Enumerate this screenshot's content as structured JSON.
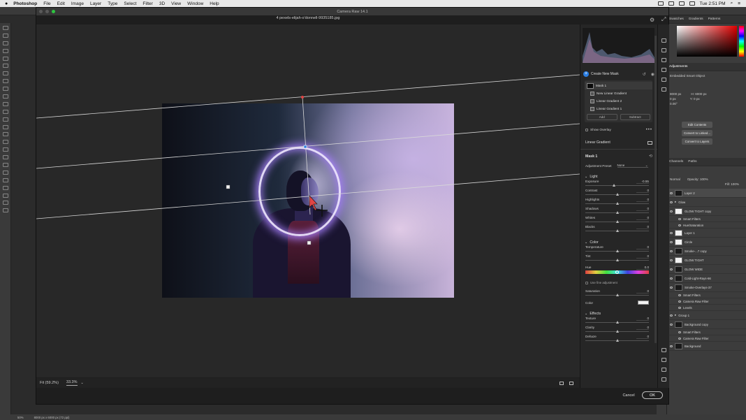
{
  "menubar": {
    "app_name": "Photoshop",
    "items": [
      "File",
      "Edit",
      "Image",
      "Layer",
      "Type",
      "Select",
      "Filter",
      "3D",
      "View",
      "Window",
      "Help"
    ],
    "clock": "Tue 2:51 PM"
  },
  "dialog": {
    "title": "Camera Raw 14.1",
    "filename": "4 pexels-elijah-o'donnell-9935185.jpg",
    "zoom_fit": "Fit (59.2%)",
    "zoom_value": "33.3%",
    "cancel_label": "Cancel",
    "ok_label": "OK"
  },
  "masks_panel": {
    "create_new": "Create New Mask",
    "masks": [
      {
        "label": "Mask 1",
        "level": 0
      },
      {
        "label": "New Linear Gradient",
        "level": 1
      },
      {
        "label": "Linear Gradient 2",
        "level": 1
      },
      {
        "label": "Linear Gradient 1",
        "level": 1
      }
    ],
    "add_label": "Add",
    "subtract_label": "Subtract",
    "show_overlay": "Show Overlay",
    "more": "•••",
    "tool_name": "Linear Gradient",
    "mask_name": "Mask 1",
    "adjustment_preset_label": "Adjustment Preset",
    "adjustment_preset_value": "None"
  },
  "light": {
    "title": "Light",
    "sliders": [
      {
        "label": "Exposure",
        "value": "-0.55",
        "pos": 0.45
      },
      {
        "label": "Contrast",
        "value": "0",
        "pos": 0.5
      },
      {
        "label": "Highlights",
        "value": "0",
        "pos": 0.5
      },
      {
        "label": "Shadows",
        "value": "0",
        "pos": 0.5
      },
      {
        "label": "Whites",
        "value": "0",
        "pos": 0.5
      },
      {
        "label": "Blacks",
        "value": "0",
        "pos": 0.5
      }
    ]
  },
  "color": {
    "title": "Color",
    "sliders": [
      {
        "label": "Temperature",
        "value": "0",
        "pos": 0.5
      },
      {
        "label": "Tint",
        "value": "0",
        "pos": 0.5
      }
    ],
    "hue_label": "Hue",
    "hue_value": "0.0",
    "hue_pos": 0.5,
    "fine_adjustment": "Use fine adjustment",
    "saturation_label": "Saturation",
    "saturation_value": "0",
    "saturation_pos": 0.5,
    "color_label": "Color",
    "swatch_color": "#f2f2f2"
  },
  "effects": {
    "title": "Effects",
    "sliders": [
      {
        "label": "Texture",
        "value": "0",
        "pos": 0.5
      },
      {
        "label": "Clarity",
        "value": "0",
        "pos": 0.5
      },
      {
        "label": "Dehaze",
        "value": "0",
        "pos": 0.5
      }
    ]
  },
  "ps_panels": {
    "top_tabs": [
      "Swatches",
      "Gradients",
      "Patterns"
    ],
    "props_tabs": [
      "Adjustments"
    ],
    "embedded_label": "Embedded Smart Object",
    "w_label": "8000 px",
    "h_label": "H: 6000 px",
    "x_label": "0 px",
    "y_label": "Y: 0 px",
    "angle": "0.00°",
    "buttons": [
      "Edit Contents",
      "Convert to Linked...",
      "Convert to Layers"
    ],
    "layer_tabs": [
      "Channels",
      "Paths"
    ],
    "blend": "Normal",
    "opacity": "Opacity: 100%",
    "fill": "Fill: 100%",
    "layers": [
      {
        "name": "Layer 2",
        "kind": "layer",
        "white": false,
        "sel": true
      },
      {
        "name": "Glow",
        "kind": "group",
        "white": false,
        "sel": false
      },
      {
        "name": "GLOW TIGHT copy",
        "kind": "layer",
        "white": true,
        "sel": false
      },
      {
        "name": "Smart Filters",
        "kind": "sub",
        "white": false,
        "sel": false
      },
      {
        "name": "Hue/Saturation",
        "kind": "sub",
        "white": false,
        "sel": false
      },
      {
        "name": "Layer 1",
        "kind": "layer",
        "white": true,
        "sel": false
      },
      {
        "name": "Circle",
        "kind": "layer",
        "white": true,
        "sel": false
      },
      {
        "name": "Smoke-...7 copy",
        "kind": "layer",
        "white": false,
        "sel": false
      },
      {
        "name": "GLOW TIGHT",
        "kind": "layer",
        "white": true,
        "sel": false
      },
      {
        "name": "GLOW WIDE",
        "kind": "layer",
        "white": false,
        "sel": false
      },
      {
        "name": "Cold-Light-Rays-66",
        "kind": "layer",
        "white": false,
        "sel": false
      },
      {
        "name": "Smoke-Overlays-37",
        "kind": "layer",
        "white": false,
        "sel": false
      },
      {
        "name": "Smart Filters",
        "kind": "sub",
        "white": false,
        "sel": false
      },
      {
        "name": "Camera Raw Filter",
        "kind": "sub",
        "white": false,
        "sel": false
      },
      {
        "name": "Levels",
        "kind": "sub",
        "white": false,
        "sel": false
      },
      {
        "name": "Group 1",
        "kind": "group",
        "white": false,
        "sel": false
      },
      {
        "name": "Background copy",
        "kind": "layer",
        "white": false,
        "sel": false
      },
      {
        "name": "Smart Filters",
        "kind": "sub",
        "white": false,
        "sel": false
      },
      {
        "name": "Camera Raw Filter",
        "kind": "sub",
        "white": false,
        "sel": false
      },
      {
        "name": "Background",
        "kind": "layer",
        "white": false,
        "sel": false
      }
    ]
  },
  "status": {
    "zoom": "50%",
    "doc": "8000 px x 6000 px (72 ppi)"
  }
}
